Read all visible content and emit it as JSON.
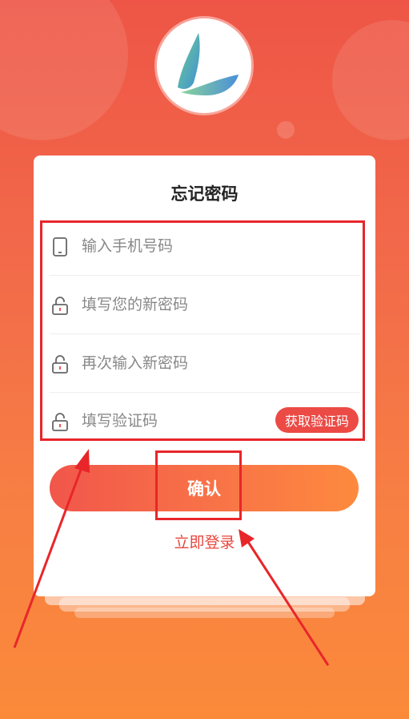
{
  "page": {
    "title": "忘记密码"
  },
  "logo": {
    "icon": "app-logo-leaf-icon"
  },
  "form": {
    "phone": {
      "value": "",
      "placeholder": "输入手机号码",
      "icon": "phone-icon"
    },
    "new_password": {
      "value": "",
      "placeholder": "填写您的新密码",
      "icon": "lock-icon"
    },
    "confirm_password": {
      "value": "",
      "placeholder": "再次输入新密码",
      "icon": "lock-icon"
    },
    "verify_code": {
      "value": "",
      "placeholder": "填写验证码",
      "icon": "lock-icon"
    },
    "get_code_label": "获取验证码"
  },
  "actions": {
    "confirm_label": "确认",
    "login_label": "立即登录"
  },
  "colors": {
    "background_top": "#ee5546",
    "background_bottom": "#fb8a3a",
    "accent_red": "#ec4a45",
    "login_link": "#e8463c",
    "annotation": "#e8262a"
  }
}
